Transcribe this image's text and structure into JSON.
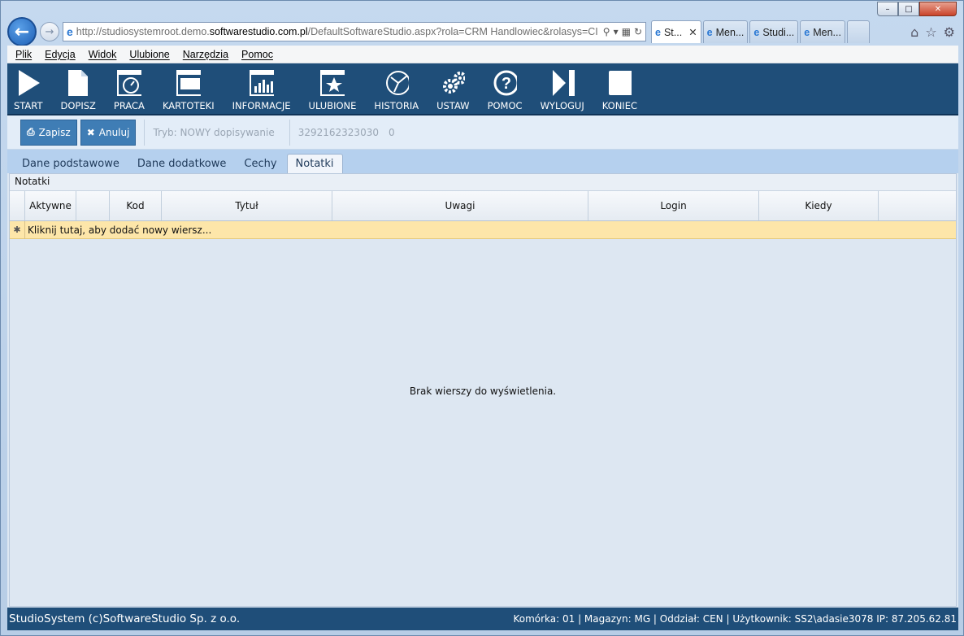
{
  "window": {
    "caption_buttons": [
      "–",
      "□",
      "✕"
    ]
  },
  "browser": {
    "url_prefix": "http://studiosystemroot.demo.",
    "url_domain": "softwarestudio.com.pl",
    "url_suffix": "/DefaultSoftwareStudio.aspx?rola=CRM Handlowiec&rolasys=CI",
    "tabs": [
      {
        "label": "St...",
        "active": true
      },
      {
        "label": "Men...",
        "active": false
      },
      {
        "label": "Studi...",
        "active": false
      },
      {
        "label": "Men...",
        "active": false
      }
    ]
  },
  "menu": [
    "Plik",
    "Edycja",
    "Widok",
    "Ulubione",
    "Narzędzia",
    "Pomoc"
  ],
  "toolbar": [
    {
      "label": "START",
      "icon": "play-icon"
    },
    {
      "label": "DOPISZ",
      "icon": "document-icon"
    },
    {
      "label": "PRACA",
      "icon": "gauge-icon"
    },
    {
      "label": "KARTOTEKI",
      "icon": "window-icon"
    },
    {
      "label": "INFORMACJE",
      "icon": "bar-chart-icon"
    },
    {
      "label": "ULUBIONE",
      "icon": "star-icon"
    },
    {
      "label": "HISTORIA",
      "icon": "history-icon"
    },
    {
      "label": "USTAW",
      "icon": "gears-icon"
    },
    {
      "label": "POMOC",
      "icon": "help-icon"
    },
    {
      "label": "WYLOGUJ",
      "icon": "logout-icon"
    },
    {
      "label": "KONIEC",
      "icon": "stop-icon"
    }
  ],
  "actions": {
    "save_label": "Zapisz",
    "cancel_label": "Anuluj",
    "mode_text": "Tryb: NOWY dopisywanie",
    "record_id": "3292162323030",
    "record_count": "0"
  },
  "page_tabs": [
    {
      "label": "Dane podstawowe",
      "active": false
    },
    {
      "label": "Dane dodatkowe",
      "active": false
    },
    {
      "label": "Cechy",
      "active": false
    },
    {
      "label": "Notatki",
      "active": true
    }
  ],
  "panel": {
    "title": "Notatki",
    "columns": [
      "Aktywne",
      "",
      "Kod",
      "Tytuł",
      "Uwagi",
      "Login",
      "Kiedy",
      ""
    ],
    "new_row_text": "Kliknij tutaj, aby dodać nowy wiersz...",
    "empty_text": "Brak wierszy do wyświetlenia."
  },
  "status": {
    "left": "StudioSystem (c)SoftwareStudio Sp. z o.o.",
    "right": "Komórka: 01 | Magazyn: MG | Oddział: CEN | Użytkownik: SS2\\adasie3078 IP: 87.205.62.81"
  }
}
